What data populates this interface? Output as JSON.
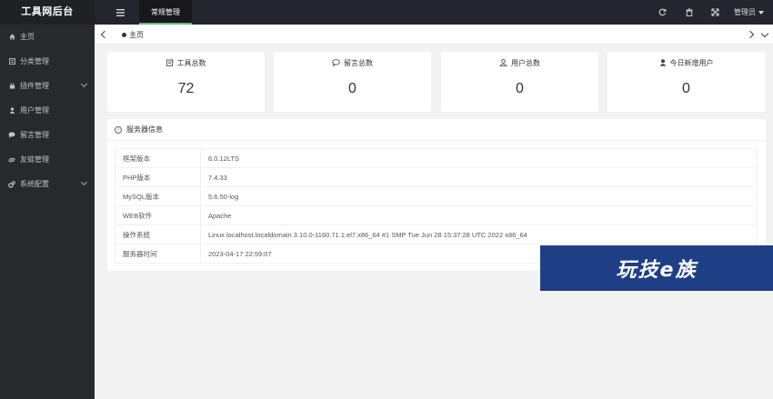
{
  "app": {
    "title": "工具网后台"
  },
  "header": {
    "active_nav": "常规管理",
    "admin_label": "管理员",
    "icons": [
      "refresh-icon",
      "trash-icon",
      "fullscreen-icon"
    ]
  },
  "sidebar": {
    "items": [
      {
        "label": "主页",
        "icon": "home-icon",
        "has_children": false
      },
      {
        "label": "分类管理",
        "icon": "category-icon",
        "has_children": false
      },
      {
        "label": "插件管理",
        "icon": "plugin-icon",
        "has_children": true
      },
      {
        "label": "用户管理",
        "icon": "user-icon",
        "has_children": false
      },
      {
        "label": "留言管理",
        "icon": "comment-icon",
        "has_children": false
      },
      {
        "label": "友链管理",
        "icon": "link-icon",
        "has_children": false
      },
      {
        "label": "系统配置",
        "icon": "settings-icon",
        "has_children": true
      }
    ]
  },
  "tabs": {
    "home": "主页"
  },
  "stats": [
    {
      "label": "工具总数",
      "value": "72",
      "icon": "tools-icon"
    },
    {
      "label": "留言总数",
      "value": "0",
      "icon": "comment-icon"
    },
    {
      "label": "用户总数",
      "value": "0",
      "icon": "users-icon"
    },
    {
      "label": "今日新增用户",
      "value": "0",
      "icon": "user-add-icon"
    }
  ],
  "server_info": {
    "title": "服务器信息",
    "rows": [
      {
        "key": "框架版本",
        "value": "6.0.12LTS"
      },
      {
        "key": "PHP版本",
        "value": "7.4.33"
      },
      {
        "key": "MySQL版本",
        "value": "5.6.50-log"
      },
      {
        "key": "WEB软件",
        "value": "Apache"
      },
      {
        "key": "操作系统",
        "value": "Linux localhost.localdomain 3.10.0-1160.71.1.el7.x86_64 #1 SMP Tue Jun 28 15:37:28 UTC 2022 x86_64"
      },
      {
        "key": "服务器时间",
        "value": "2023-04-17 22:59:07"
      }
    ]
  },
  "watermark": {
    "text": "玩技e族"
  },
  "colors": {
    "topbar": "#23262e",
    "sidebar": "#28292d",
    "accent": "#5fb878",
    "watermark_bg": "#1e3f86"
  }
}
